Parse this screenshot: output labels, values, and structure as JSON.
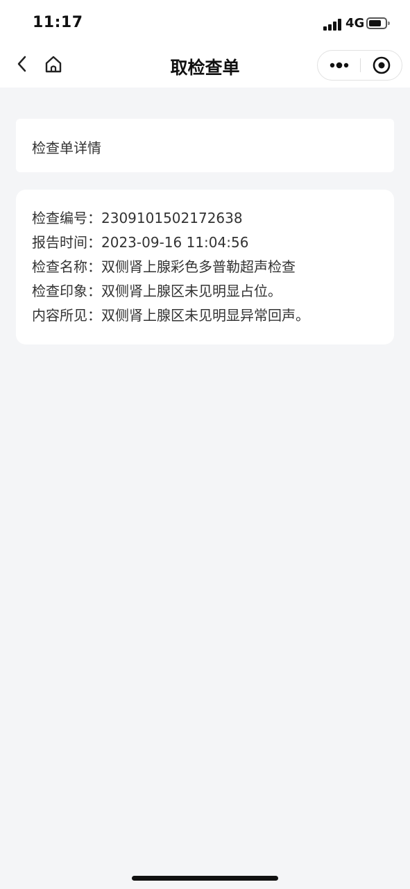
{
  "status_bar": {
    "time": "11:17",
    "network": "4G",
    "signal_bars": 4,
    "battery_level_percent": 75
  },
  "navbar": {
    "title": "取检查单",
    "icons": [
      "back-arrow-icon",
      "home-icon",
      "more-dots-icon",
      "target-close-icon"
    ]
  },
  "section_title": "检查单详情",
  "details": [
    {
      "label": "检查编号：",
      "value": "2309101502172638"
    },
    {
      "label": "报告时间：",
      "value": "2023-09-16 11:04:56"
    },
    {
      "label": "检查名称：",
      "value": "双侧肾上腺彩色多普勒超声检查"
    },
    {
      "label": "检查印象：",
      "value": "双侧肾上腺区未见明显占位。"
    },
    {
      "label": "内容所见：",
      "value": "双侧肾上腺区未见明显异常回声。"
    }
  ],
  "colors": {
    "background": "#f4f5f7",
    "card": "#ffffff",
    "text": "#333333"
  }
}
